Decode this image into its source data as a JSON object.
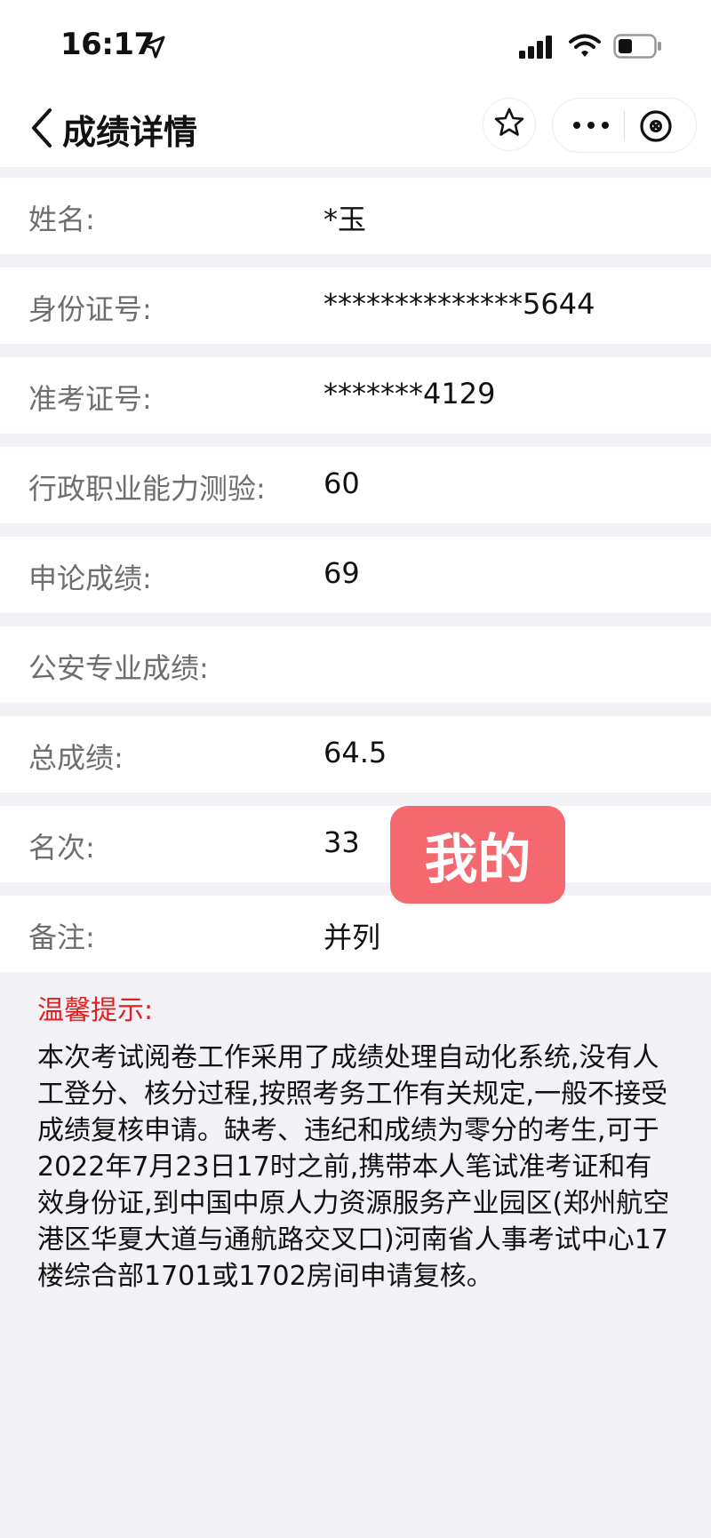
{
  "status_bar": {
    "time": "16:17"
  },
  "nav": {
    "title": "成绩详情"
  },
  "rows": [
    {
      "label": "姓名:",
      "value": "*玉"
    },
    {
      "label": "身份证号:",
      "value": "**************5644"
    },
    {
      "label": "准考证号:",
      "value": "*******4129"
    },
    {
      "label": "行政职业能力测验:",
      "value": "60"
    },
    {
      "label": "申论成绩:",
      "value": "69"
    },
    {
      "label": "公安专业成绩:",
      "value": ""
    },
    {
      "label": "总成绩:",
      "value": "64.5"
    },
    {
      "label": "名次:",
      "value": "33"
    },
    {
      "label": "备注:",
      "value": "并列"
    }
  ],
  "sticker": {
    "text": "我的"
  },
  "tips": {
    "title": "温馨提示:",
    "body": "本次考试阅卷工作采用了成绩处理自动化系统,没有人工登分、核分过程,按照考务工作有关规定,一般不接受成绩复核申请。缺考、违纪和成绩为零分的考生,可于2022年7月23日17时之前,携带本人笔试准考证和有效身份证,到中国中原人力资源服务产业园区(郑州航空港区华夏大道与通航路交叉口)河南省人事考试中心17楼综合部1701或1702房间申请复核。"
  },
  "colors": {
    "tips_title": "#e02020",
    "sticker_bg": "#f3696f",
    "label_gray": "#6e6e6e",
    "page_bg": "#f2f2f6"
  },
  "icons": [
    "location-arrow-icon",
    "signal-icon",
    "wifi-icon",
    "battery-icon",
    "back-chevron-icon",
    "star-icon",
    "more-dots-icon",
    "close-circle-icon"
  ]
}
